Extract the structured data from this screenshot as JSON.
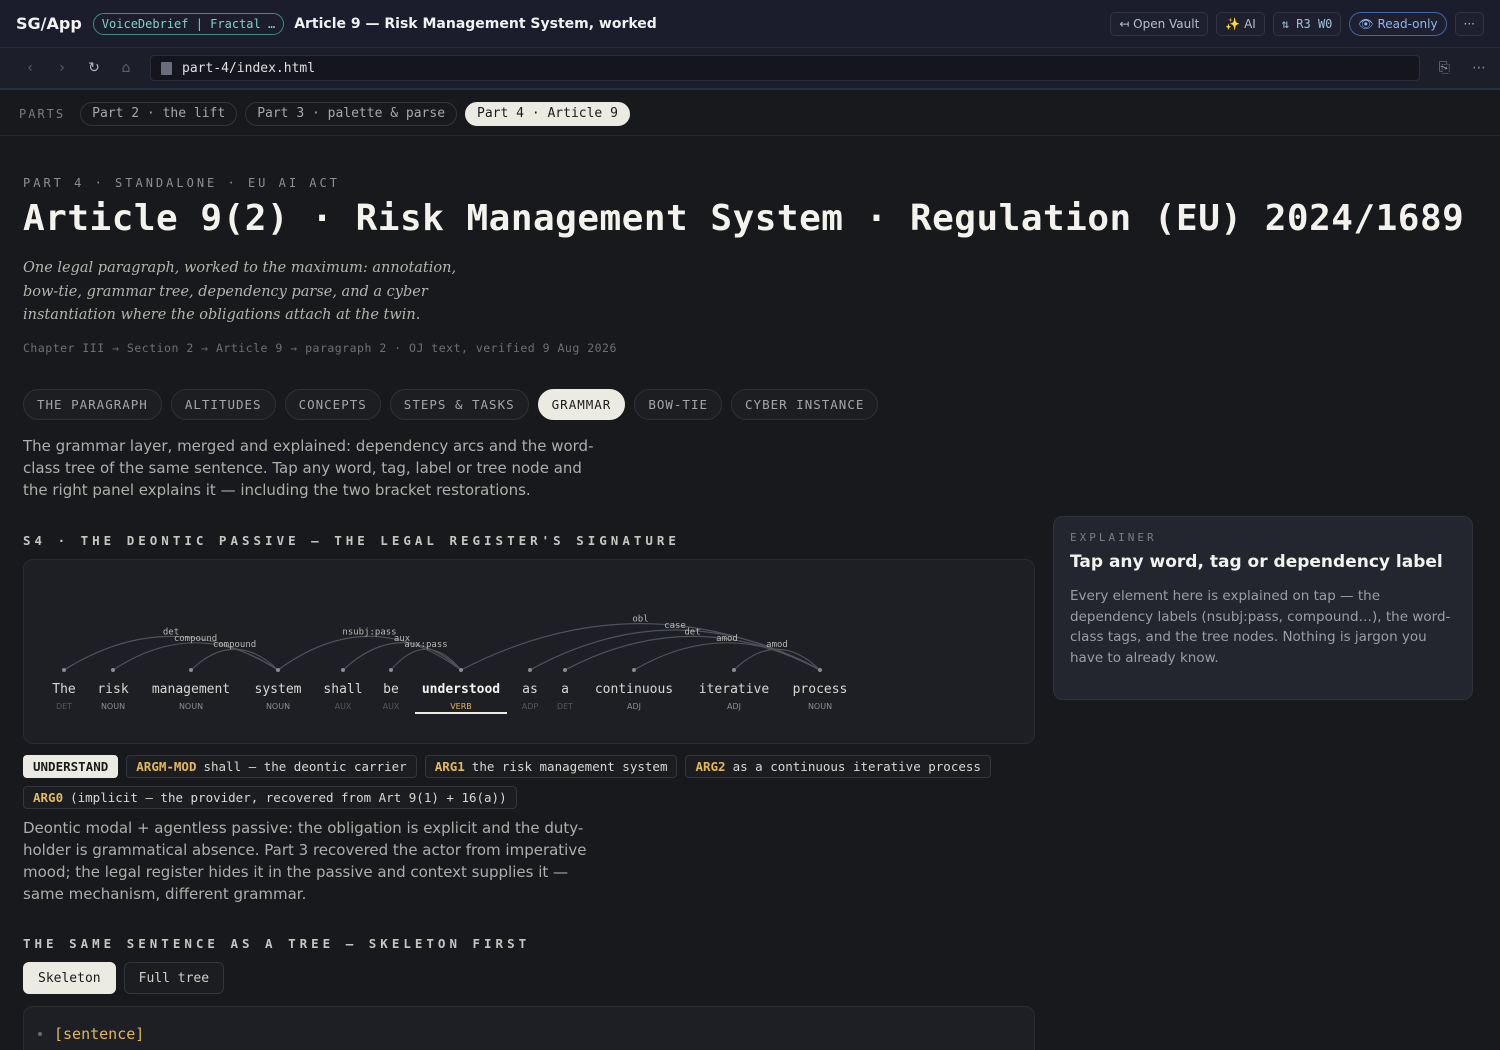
{
  "app": {
    "brand": "SG/App",
    "vault": "VoiceDebrief | Fractal …",
    "doc_title": "Article 9 — Risk Management System, worked",
    "buttons": {
      "open_vault": "↤ Open Vault",
      "ai": "✨ AI",
      "rw": "⇅ R3  W0",
      "readonly": "👁 Read-only",
      "more": "···"
    }
  },
  "address": {
    "url": "part-4/index.html"
  },
  "parts": {
    "label": "PARTS",
    "items": [
      "Part 2 · the lift",
      "Part 3 · palette & parse",
      "Part 4 · Article 9"
    ],
    "active_index": 2
  },
  "page": {
    "eyebrow": "PART 4 · STANDALONE · EU AI ACT",
    "title": "Article 9(2) · Risk Management System · Regulation (EU) 2024/1689",
    "lede": "One legal paragraph, worked to the maximum: annotation, bow-tie, grammar tree, dependency parse, and a cyber instantiation where the obligations attach at the twin.",
    "crumb": "Chapter III → Section 2 → Article 9 → paragraph 2 · OJ text, verified 9 Aug 2026",
    "tabs": [
      "THE PARAGRAPH",
      "ALTITUDES",
      "CONCEPTS",
      "STEPS & TASKS",
      "GRAMMAR",
      "BOW-TIE",
      "CYBER INSTANCE"
    ],
    "active_tab": 4,
    "intro": "The grammar layer, merged and explained: dependency arcs and the word-class tree of the same sentence. Tap any word, tag, label or tree node and the right panel explains it — including the two bracket restorations."
  },
  "dependency": {
    "heading": "S4 · THE DEONTIC PASSIVE — THE LEGAL REGISTER'S SIGNATURE",
    "tokens": [
      {
        "word": "The",
        "tag": "DET"
      },
      {
        "word": "risk",
        "tag": "NOUN"
      },
      {
        "word": "management",
        "tag": "NOUN"
      },
      {
        "word": "system",
        "tag": "NOUN"
      },
      {
        "word": "shall",
        "tag": "AUX"
      },
      {
        "word": "be",
        "tag": "AUX"
      },
      {
        "word": "understood",
        "tag": "VERB"
      },
      {
        "word": "as",
        "tag": "ADP"
      },
      {
        "word": "a",
        "tag": "DET"
      },
      {
        "word": "continuous",
        "tag": "ADJ"
      },
      {
        "word": "iterative",
        "tag": "ADJ"
      },
      {
        "word": "process",
        "tag": "NOUN"
      }
    ],
    "selected_index": 6,
    "arcs": [
      {
        "label": "det",
        "head": 3,
        "dep": 0
      },
      {
        "label": "compound",
        "head": 3,
        "dep": 1
      },
      {
        "label": "compound",
        "head": 3,
        "dep": 2
      },
      {
        "label": "nsubj:pass",
        "head": 6,
        "dep": 3
      },
      {
        "label": "aux",
        "head": 6,
        "dep": 4
      },
      {
        "label": "aux:pass",
        "head": 6,
        "dep": 5
      },
      {
        "label": "obl",
        "head": 6,
        "dep": 11
      },
      {
        "label": "case",
        "head": 11,
        "dep": 7
      },
      {
        "label": "det",
        "head": 11,
        "dep": 8
      },
      {
        "label": "amod",
        "head": 11,
        "dep": 9
      },
      {
        "label": "amod",
        "head": 11,
        "dep": 10
      }
    ]
  },
  "srl": {
    "verb": "UNDERSTAND",
    "roles": [
      {
        "role": "ARGM-MOD",
        "text": "shall — the deontic carrier"
      },
      {
        "role": "ARG1",
        "text": "the risk management system"
      },
      {
        "role": "ARG2",
        "text": "as a continuous iterative process"
      },
      {
        "role": "ARG0",
        "text": "(implicit — the provider, recovered from Art 9(1) + 16(a))"
      }
    ],
    "note": "Deontic modal + agentless passive: the obligation is explicit and the duty-holder is grammatical absence. Part 3 recovered the actor from imperative mood; the legal register hides it in the passive and context supplies it — same mechanism, different grammar."
  },
  "tree": {
    "heading": "THE SAME SENTENCE AS A TREE — SKELETON FIRST",
    "toggle": [
      "Skeleton",
      "Full tree"
    ],
    "active_toggle": 0,
    "root": "[sentence]"
  },
  "explainer": {
    "eyebrow": "EXPLAINER",
    "title": "Tap any word, tag or dependency label",
    "body": "Every element here is explained on tap — the dependency labels (nsubj:pass, compound…), the word-class tags, and the tree nodes. Nothing is jargon you have to already know."
  },
  "colors": {
    "accent_role": "#e2b75e",
    "active_chip": "#ecebe2",
    "vault": "#7fd3c6",
    "readonly": "#8fb4f2"
  }
}
